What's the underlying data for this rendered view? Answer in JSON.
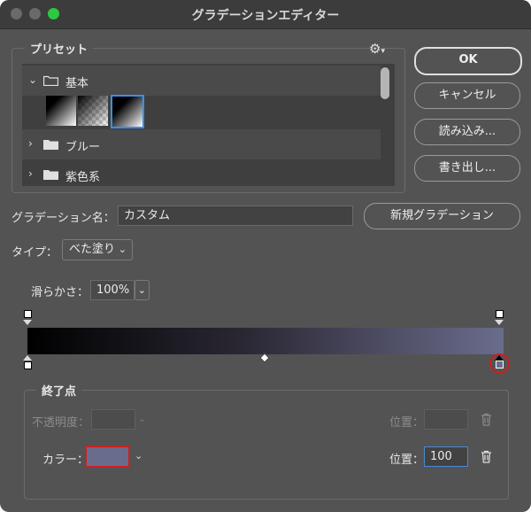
{
  "window": {
    "title": "グラデーションエディター"
  },
  "presets": {
    "label": "プリセット",
    "folders": [
      {
        "name": "基本",
        "expanded": true
      },
      {
        "name": "ブルー",
        "expanded": false
      },
      {
        "name": "紫色系",
        "expanded": false
      }
    ],
    "swatches": [
      "black-to-white",
      "black-to-transparent",
      "black-to-white-selected"
    ]
  },
  "buttons": {
    "ok": "OK",
    "cancel": "キャンセル",
    "load": "読み込み...",
    "save": "書き出し...",
    "new_gradient": "新規グラデーション"
  },
  "name_field": {
    "label": "グラデーション名：",
    "value": "カスタム"
  },
  "type": {
    "label": "タイプ：",
    "value": "べた塗り"
  },
  "smoothness": {
    "label": "滑らかさ：",
    "value": "100%"
  },
  "stops": {
    "legend": "終了点",
    "opacity_label": "不透明度：",
    "opacity_value": "",
    "opacity_location_label": "位置：",
    "opacity_location_value": "",
    "color_label": "カラー：",
    "color_location_label": "位置：",
    "color_location_value": "100",
    "selected_color": "#6a6c8c"
  },
  "gradient": {
    "start_color": "#000000",
    "end_color": "#6a6c8c"
  },
  "icons": {
    "gear": "gear-icon",
    "trash": "trash-icon",
    "folder": "folder-icon"
  }
}
